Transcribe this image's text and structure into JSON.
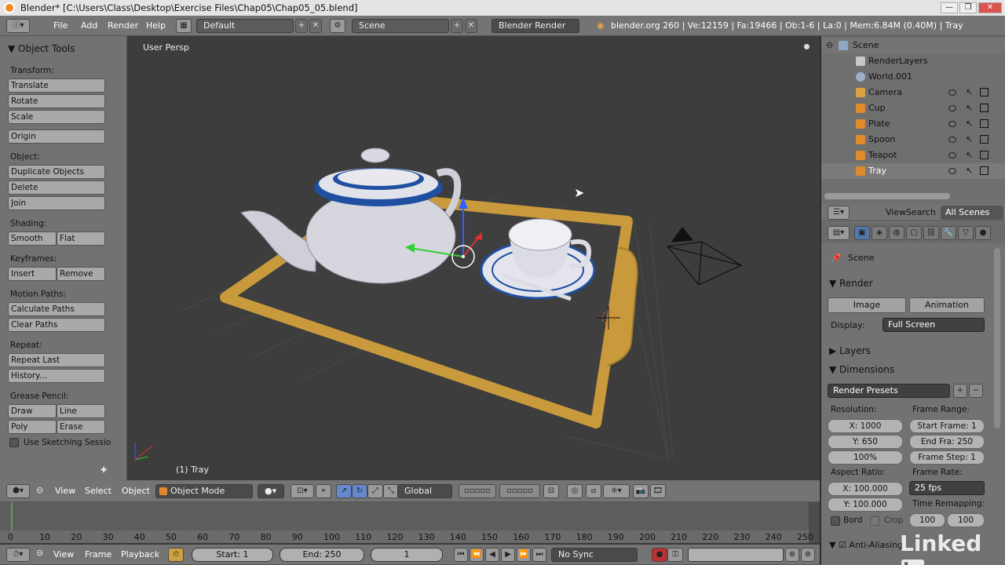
{
  "window": {
    "title": "Blender* [C:\\Users\\Class\\Desktop\\Exercise Files\\Chap05\\Chap05_05.blend]",
    "minimize": "—",
    "maximize": "❐",
    "close": "✕"
  },
  "info_header": {
    "menus": [
      "File",
      "Add",
      "Render",
      "Help"
    ],
    "screen_layout": "Default",
    "scene": "Scene",
    "render_engine": "Blender Render",
    "stats": "blender.org 260 | Ve:12159 | Fa:19466 | Ob:1-6 | La:0 | Mem:6.84M (0.40M) | Tray"
  },
  "toolshelf": {
    "title": "Object Tools",
    "transform_label": "Transform:",
    "translate": "Translate",
    "rotate": "Rotate",
    "scale": "Scale",
    "origin": "Origin",
    "object_label": "Object:",
    "duplicate": "Duplicate Objects",
    "delete": "Delete",
    "join": "Join",
    "shading_label": "Shading:",
    "smooth": "Smooth",
    "flat": "Flat",
    "keyframes_label": "Keyframes:",
    "insert": "Insert",
    "remove": "Remove",
    "motion_label": "Motion Paths:",
    "calc_paths": "Calculate Paths",
    "clear_paths": "Clear Paths",
    "repeat_label": "Repeat:",
    "repeat_last": "Repeat Last",
    "history": "History...",
    "grease_label": "Grease Pencil:",
    "draw": "Draw",
    "line": "Line",
    "poly": "Poly",
    "erase": "Erase",
    "sketching": "Use Sketching Sessio"
  },
  "viewport": {
    "view_label": "User Persp",
    "object_label": "(1) Tray"
  },
  "outliner": {
    "items": [
      {
        "name": "Scene",
        "color": "#8fa8c8"
      },
      {
        "name": "RenderLayers",
        "color": "#c8c8c8"
      },
      {
        "name": "World.001",
        "color": "#9ab0c8"
      },
      {
        "name": "Camera",
        "color": "#d9a441"
      },
      {
        "name": "Cup",
        "color": "#e08a2c"
      },
      {
        "name": "Plate",
        "color": "#e08a2c"
      },
      {
        "name": "Spoon",
        "color": "#e08a2c"
      },
      {
        "name": "Teapot",
        "color": "#e08a2c"
      },
      {
        "name": "Tray",
        "color": "#e08a2c"
      }
    ],
    "footer": {
      "view": "View",
      "search": "Search",
      "all_scenes": "All Scenes"
    }
  },
  "properties": {
    "scene": "Scene",
    "render_section": "Render",
    "image_btn": "Image",
    "animation_btn": "Animation",
    "display_label": "Display:",
    "display_value": "Full Screen",
    "layers_section": "Layers",
    "dimensions_section": "Dimensions",
    "render_presets": "Render Presets",
    "resolution_label": "Resolution:",
    "res_x": "X: 1000",
    "res_y": "Y: 650",
    "res_pct": "100%",
    "frame_range_label": "Frame Range:",
    "start_frame": "Start Frame: 1",
    "end_frame": "End Fra: 250",
    "frame_step": "Frame Step: 1",
    "aspect_label": "Aspect Ratio:",
    "aspect_x": "X: 100.000",
    "aspect_y": "Y: 100.000",
    "frame_rate_label": "Frame Rate:",
    "frame_rate": "25 fps",
    "time_remap_label": "Time Remapping:",
    "remap_old": "100",
    "remap_new": "100",
    "border": "Bord",
    "crop": "Crop",
    "anti_alias": "Anti-Aliasing"
  },
  "viewport_header": {
    "view": "View",
    "select": "Select",
    "object": "Object",
    "mode": "Object Mode",
    "orientation": "Global"
  },
  "timeline": {
    "ticks": [
      "0",
      "10",
      "20",
      "30",
      "40",
      "50",
      "60",
      "70",
      "80",
      "90",
      "100",
      "110",
      "120",
      "130",
      "140",
      "150",
      "160",
      "170",
      "180",
      "190",
      "200",
      "210",
      "220",
      "230",
      "240",
      "250"
    ]
  },
  "timeline_header": {
    "view": "View",
    "frame": "Frame",
    "playback": "Playback",
    "start": "Start: 1",
    "end": "End: 250",
    "current": "1",
    "sync": "No Sync"
  },
  "watermark": {
    "brand": "Linked",
    "in": "in"
  }
}
